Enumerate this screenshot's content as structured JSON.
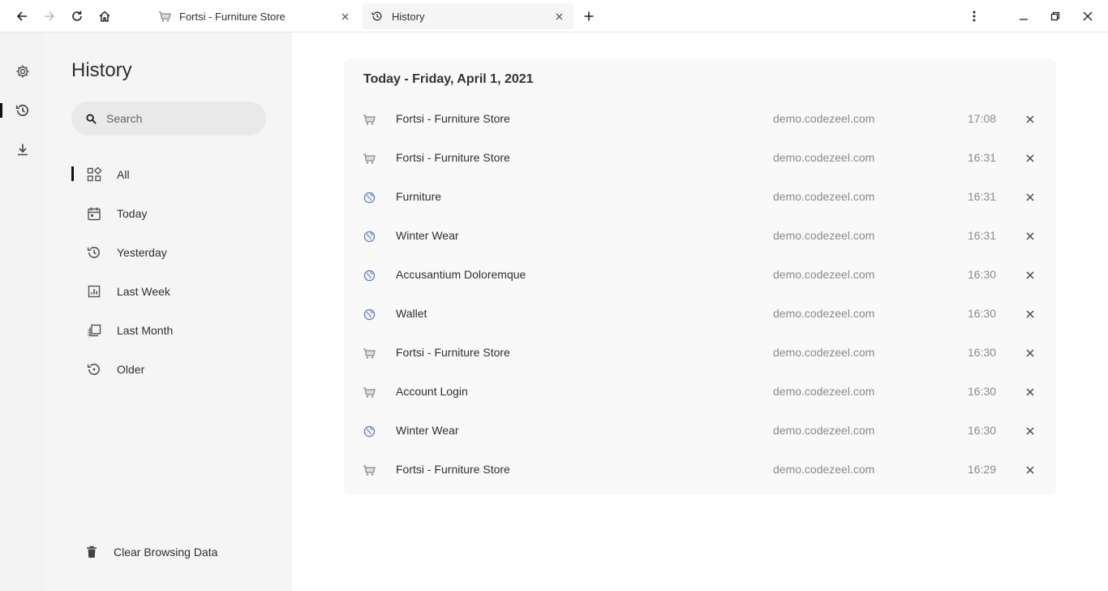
{
  "browser": {
    "nav": {
      "back_icon": "arrow-left-icon",
      "forward_icon": "arrow-right-icon",
      "reload_icon": "reload-icon",
      "home_icon": "home-icon"
    },
    "tabs": [
      {
        "label": "Fortsi - Furniture Store",
        "icon": "cart-icon",
        "active": false
      },
      {
        "label": "History",
        "icon": "history-icon",
        "active": true
      }
    ],
    "new_tab_icon": "plus-icon",
    "menu_icon": "kebab-menu-icon",
    "window_controls": [
      "minimize-icon",
      "restore-icon",
      "close-icon"
    ]
  },
  "rail": {
    "items": [
      {
        "name": "settings",
        "icon": "gear-icon",
        "active": false
      },
      {
        "name": "history",
        "icon": "history-icon",
        "active": true
      },
      {
        "name": "downloads",
        "icon": "download-icon",
        "active": false
      }
    ]
  },
  "sidebar": {
    "title": "History",
    "search": {
      "placeholder": "Search",
      "value": ""
    },
    "items": [
      {
        "label": "All",
        "icon": "apps-icon",
        "active": true
      },
      {
        "label": "Today",
        "icon": "calendar-icon",
        "active": false
      },
      {
        "label": "Yesterday",
        "icon": "history-icon",
        "active": false
      },
      {
        "label": "Last Week",
        "icon": "chart-icon",
        "active": false
      },
      {
        "label": "Last Month",
        "icon": "library-icon",
        "active": false
      },
      {
        "label": "Older",
        "icon": "restore-icon",
        "active": false
      }
    ],
    "clear_label": "Clear Browsing Data",
    "clear_icon": "trash-icon"
  },
  "main": {
    "group_title": "Today - Friday, April 1, 2021",
    "entries": [
      {
        "title": "Fortsi - Furniture Store",
        "domain": "demo.codezeel.com",
        "time": "17:08",
        "favicon": "cart-icon"
      },
      {
        "title": "Fortsi - Furniture Store",
        "domain": "demo.codezeel.com",
        "time": "16:31",
        "favicon": "cart-icon"
      },
      {
        "title": "Furniture",
        "domain": "demo.codezeel.com",
        "time": "16:31",
        "favicon": "globe-icon"
      },
      {
        "title": "Winter Wear",
        "domain": "demo.codezeel.com",
        "time": "16:31",
        "favicon": "globe-icon"
      },
      {
        "title": "Accusantium Doloremque",
        "domain": "demo.codezeel.com",
        "time": "16:30",
        "favicon": "globe-icon"
      },
      {
        "title": "Wallet",
        "domain": "demo.codezeel.com",
        "time": "16:30",
        "favicon": "globe-icon"
      },
      {
        "title": "Fortsi - Furniture Store",
        "domain": "demo.codezeel.com",
        "time": "16:30",
        "favicon": "cart-icon"
      },
      {
        "title": "Account Login",
        "domain": "demo.codezeel.com",
        "time": "16:30",
        "favicon": "cart-icon"
      },
      {
        "title": "Winter Wear",
        "domain": "demo.codezeel.com",
        "time": "16:30",
        "favicon": "globe-icon"
      },
      {
        "title": "Fortsi - Furniture Store",
        "domain": "demo.codezeel.com",
        "time": "16:29",
        "favicon": "cart-icon"
      }
    ]
  },
  "colors": {
    "sidebar_bg": "#f5f5f5",
    "rail_bg": "#f3f3f3",
    "card_bg": "#f9f9f9",
    "accent_indicator": "#111111",
    "muted_text": "#8a8a8a"
  }
}
